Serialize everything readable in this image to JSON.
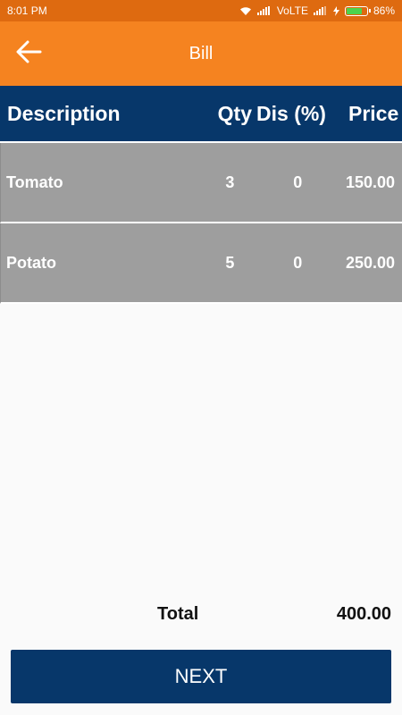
{
  "status_bar": {
    "time": "8:01 PM",
    "network": "VoLTE",
    "battery": "86%",
    "battery_level": 0.86
  },
  "app_bar": {
    "title": "Bill",
    "back_icon": "arrow-left-icon"
  },
  "table": {
    "headers": {
      "description": "Description",
      "qty": "Qty",
      "discount": "Dis (%)",
      "price": "Price"
    },
    "rows": [
      {
        "description": "Tomato",
        "qty": "3",
        "discount": "0",
        "price": "150.00"
      },
      {
        "description": "Potato",
        "qty": "5",
        "discount": "0",
        "price": "250.00"
      }
    ]
  },
  "total": {
    "label": "Total",
    "value": "400.00"
  },
  "next_button": {
    "label": "NEXT"
  },
  "colors": {
    "status_bar": "#de6a10",
    "app_bar": "#f58320",
    "primary": "#07376a",
    "row_bg": "#9e9e9e"
  }
}
